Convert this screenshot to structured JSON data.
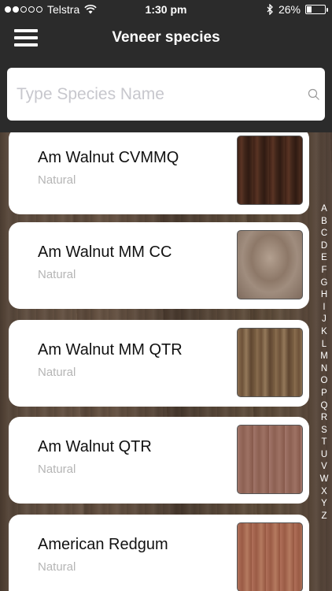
{
  "status_bar": {
    "carrier": "Telstra",
    "time": "1:30 pm",
    "battery": "26%",
    "battery_level": 0.26,
    "signal_bars": 2
  },
  "nav": {
    "title": "Veneer species",
    "menu_icon": "hamburger-menu-icon"
  },
  "search": {
    "placeholder": "Type Species Name",
    "value": "",
    "icon": "search-icon"
  },
  "species": [
    {
      "name": "Am Walnut CVMMQ",
      "finish": "Natural",
      "swatch_color": "#4a2a1c"
    },
    {
      "name": "Am Walnut MM CC",
      "finish": "Natural",
      "swatch_color": "#9a8676"
    },
    {
      "name": "Am Walnut MM QTR",
      "finish": "Natural",
      "swatch_color": "#7d6246"
    },
    {
      "name": "Am Walnut QTR",
      "finish": "Natural",
      "swatch_color": "#94685a"
    },
    {
      "name": "American Redgum",
      "finish": "Natural",
      "swatch_color": "#a86a50"
    }
  ],
  "alphabet_index": [
    "A",
    "B",
    "C",
    "D",
    "E",
    "F",
    "G",
    "H",
    "I",
    "J",
    "K",
    "L",
    "M",
    "N",
    "O",
    "P",
    "Q",
    "R",
    "S",
    "T",
    "U",
    "V",
    "W",
    "X",
    "Y",
    "Z"
  ]
}
